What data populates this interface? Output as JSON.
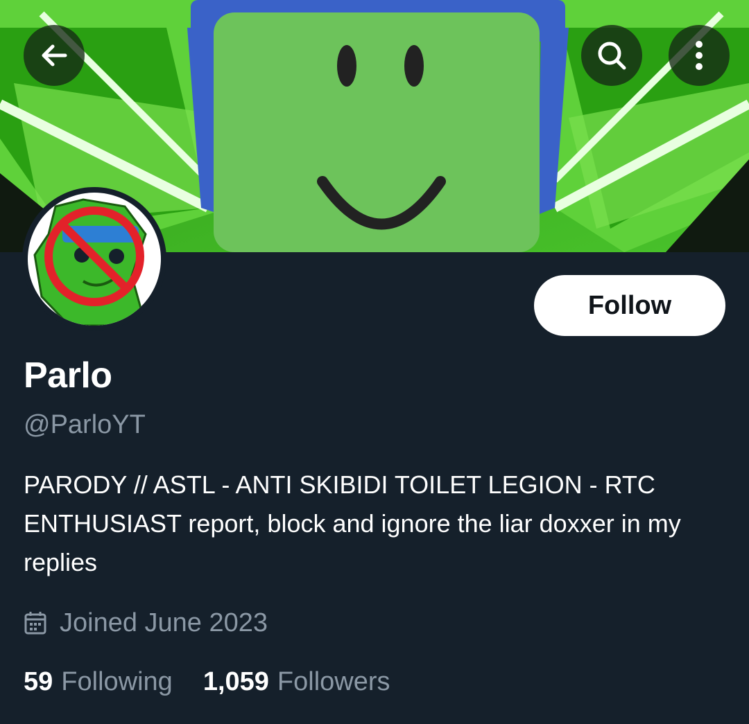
{
  "header": {
    "back_icon": "arrow-left-icon",
    "search_icon": "search-icon",
    "more_icon": "more-vertical-icon"
  },
  "profile": {
    "display_name": "Parlo",
    "handle": "@ParloYT",
    "bio": "PARODY // ASTL - ANTI SKIBIDI TOILET LEGION - RTC ENTHUSIAST report, block and ignore the liar doxxer in my replies",
    "joined": "Joined June 2023",
    "joined_icon": "calendar-icon",
    "follow_label": "Follow"
  },
  "stats": {
    "following_count": "59",
    "following_label": "Following",
    "followers_count": "1,059",
    "followers_label": "Followers"
  },
  "colors": {
    "background": "#15202b",
    "secondary_text": "#8b98a5",
    "banner_green": "#3bb31f"
  }
}
